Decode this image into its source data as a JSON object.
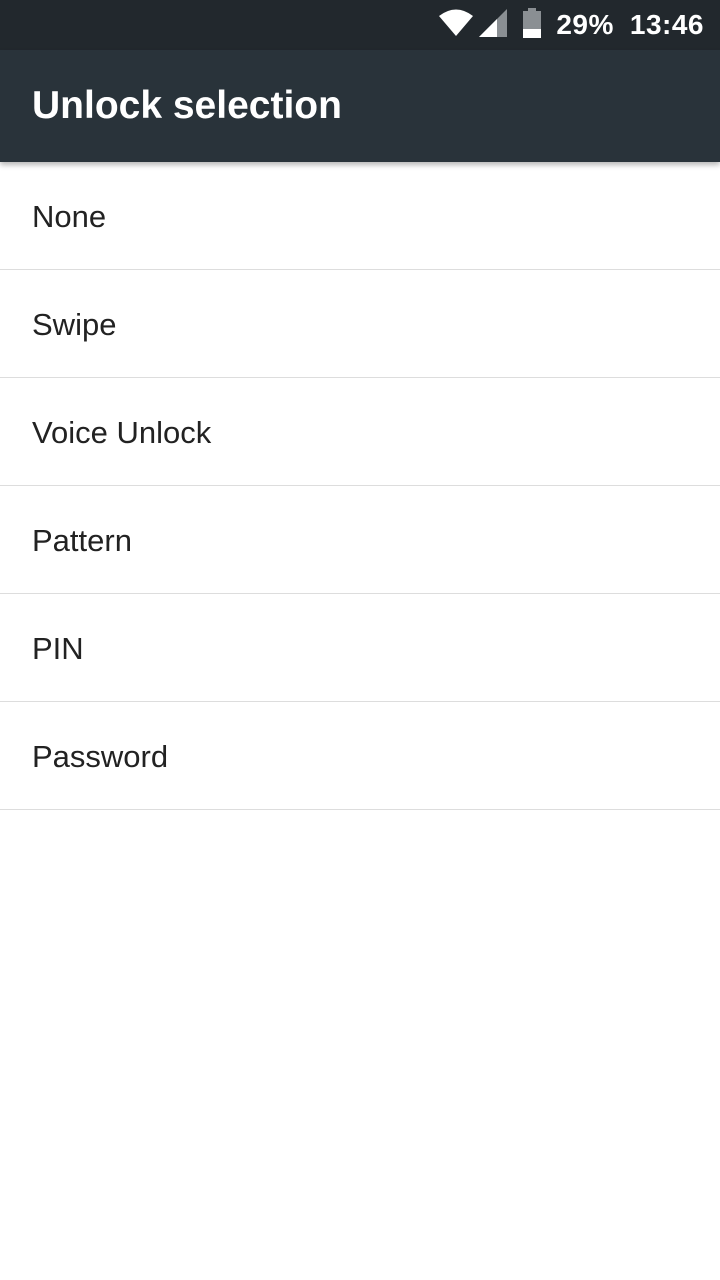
{
  "status_bar": {
    "wifi_icon": "wifi-icon",
    "signal_icon": "cellular-signal-icon",
    "battery_icon": "battery-icon",
    "battery_percent": "29%",
    "time": "13:46"
  },
  "app_bar": {
    "title": "Unlock selection"
  },
  "options": [
    {
      "label": "None"
    },
    {
      "label": "Swipe"
    },
    {
      "label": "Voice Unlock"
    },
    {
      "label": "Pattern"
    },
    {
      "label": "PIN"
    },
    {
      "label": "Password"
    }
  ],
  "colors": {
    "status_bar_bg": "#22282d",
    "app_bar_bg": "#29333a",
    "divider": "#dddddd",
    "text_primary": "#222222"
  }
}
